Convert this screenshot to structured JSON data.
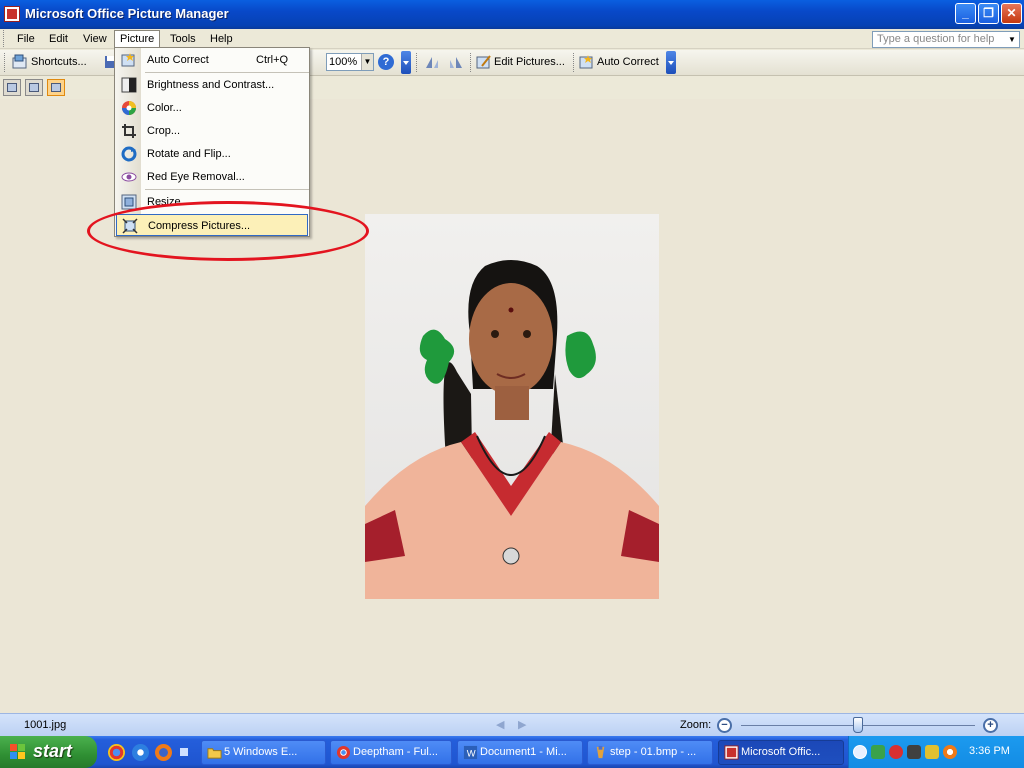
{
  "window": {
    "title": "Microsoft Office Picture Manager",
    "min": "_",
    "max": "❐",
    "close": "✕"
  },
  "menubar": {
    "items": [
      "File",
      "Edit",
      "View",
      "Picture",
      "Tools",
      "Help"
    ],
    "ask_placeholder": "Type a question for help"
  },
  "toolbar": {
    "shortcuts": "Shortcuts...",
    "zoom": "100%",
    "edit_pictures": "Edit Pictures...",
    "auto_correct": "Auto Correct"
  },
  "picture_menu": {
    "items": [
      {
        "label": "Auto Correct",
        "shortcut": "Ctrl+Q"
      },
      {
        "label": "Brightness and Contrast..."
      },
      {
        "label": "Color..."
      },
      {
        "label": "Crop..."
      },
      {
        "label": "Rotate and Flip..."
      },
      {
        "label": "Red Eye Removal..."
      },
      {
        "label": "Resize..."
      },
      {
        "label": "Compress Pictures..."
      }
    ],
    "highlighted": "Compress Pictures..."
  },
  "status": {
    "filename": "1001.jpg",
    "zoom_label": "Zoom:"
  },
  "taskbar": {
    "start": "start",
    "buttons": [
      "5 Windows E...",
      "Deeptham - Ful...",
      "Document1 - Mi...",
      "step - 01.bmp - ...",
      "Microsoft Offic..."
    ],
    "clock": "3:36 PM"
  },
  "colors": {
    "highlight": "#fcf0b8",
    "annotation": "#e3141f",
    "taskbar": "#245edb"
  }
}
